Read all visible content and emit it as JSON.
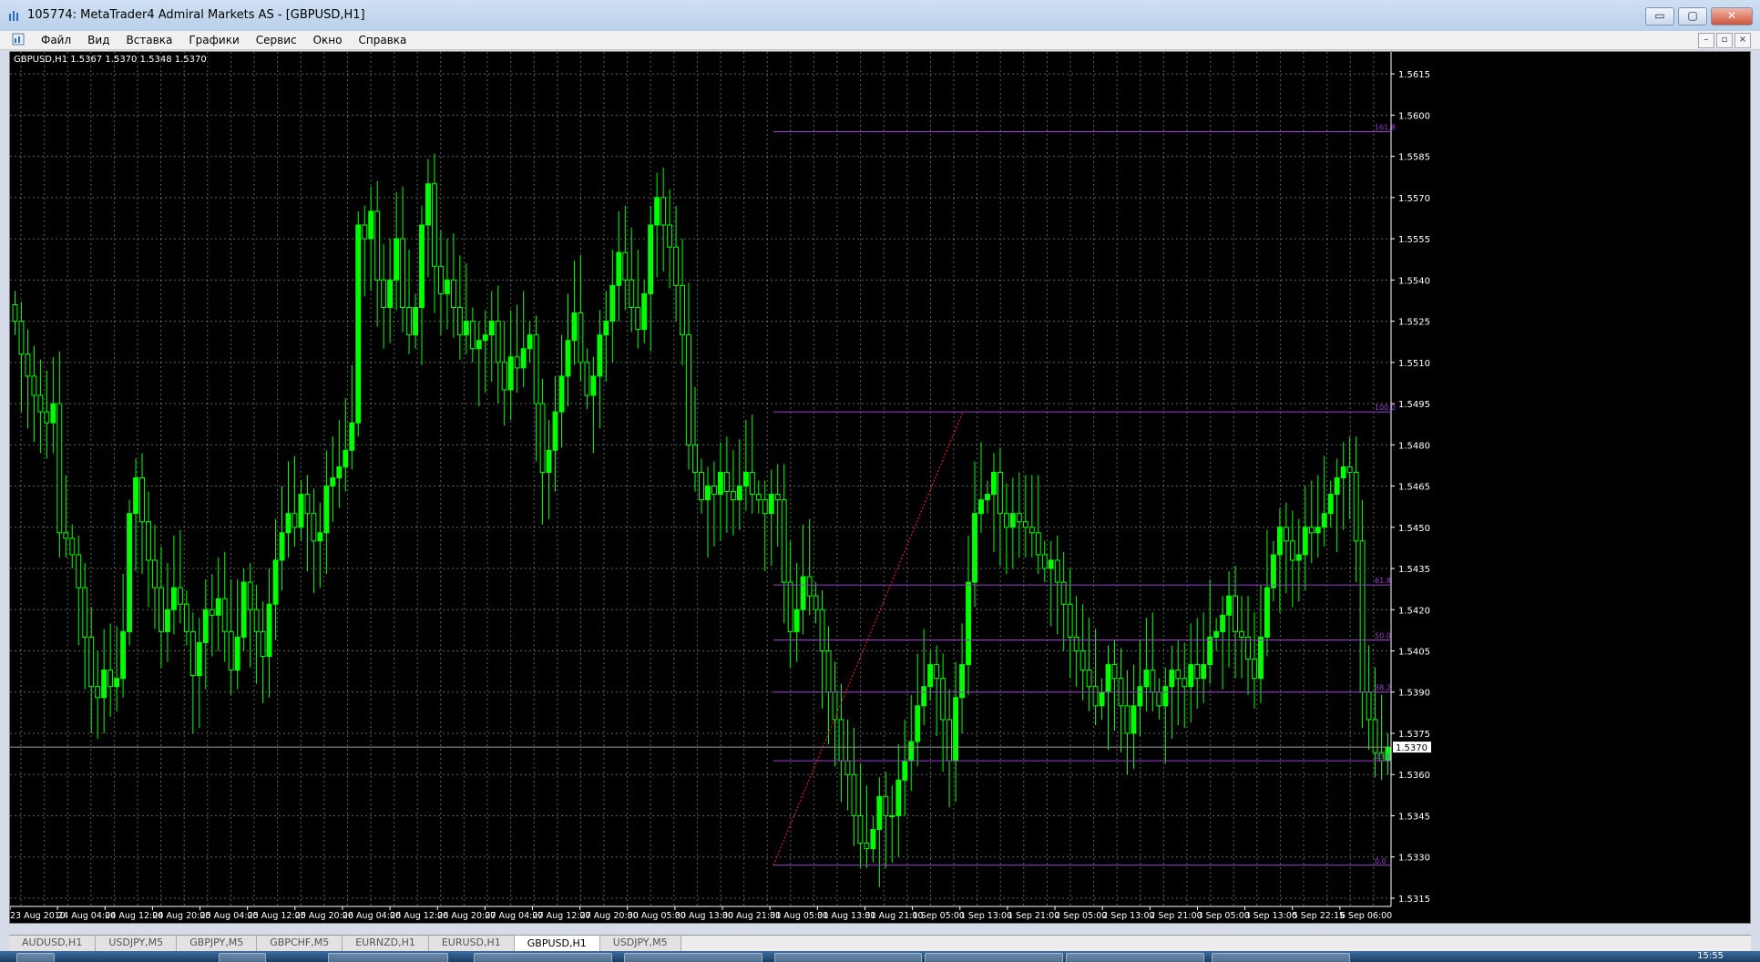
{
  "window": {
    "title": "105774: MetaTrader4 Admiral Markets AS - [GBPUSD,H1]",
    "controls": {
      "minimize": "▭",
      "restore": "▢",
      "close": "✕"
    }
  },
  "menu": {
    "items": [
      "Файл",
      "Вид",
      "Вставка",
      "Графики",
      "Сервис",
      "Окно",
      "Справка"
    ],
    "mdi_controls": {
      "minimize": "–",
      "restore": "▫",
      "close": "×"
    }
  },
  "chart_data": {
    "type": "candlestick",
    "symbol_header": "GBPUSD,H1  1.5367 1.5370 1.5348 1.5370",
    "current_price": "1.5370",
    "price_axis": [
      "1.5615",
      "1.5600",
      "1.5585",
      "1.5570",
      "1.5555",
      "1.5540",
      "1.5525",
      "1.5510",
      "1.5495",
      "1.5480",
      "1.5465",
      "1.5450",
      "1.5435",
      "1.5420",
      "1.5405",
      "1.5390",
      "1.5375",
      "1.5360",
      "1.5345",
      "1.5330",
      "1.5315"
    ],
    "ylim": [
      1.5312,
      1.5623
    ],
    "time_axis": [
      "23 Aug 2010",
      "24 Aug 04:00",
      "24 Aug 12:00",
      "24 Aug 20:00",
      "25 Aug 04:00",
      "25 Aug 12:00",
      "25 Aug 20:00",
      "26 Aug 04:00",
      "26 Aug 12:00",
      "26 Aug 20:00",
      "27 Aug 04:00",
      "27 Aug 12:00",
      "27 Aug 20:00",
      "30 Aug 05:00",
      "30 Aug 13:00",
      "30 Aug 21:00",
      "31 Aug 05:00",
      "31 Aug 13:00",
      "31 Aug 21:00",
      "1 Sep 05:00",
      "1 Sep 13:00",
      "1 Sep 21:00",
      "2 Sep 05:00",
      "2 Sep 13:00",
      "2 Sep 21:00",
      "3 Sep 05:00",
      "3 Sep 13:00",
      "5 Sep 22:15",
      "6 Sep 06:00"
    ],
    "closes": [
      1.5525,
      1.5513,
      1.5505,
      1.5498,
      1.5492,
      1.5488,
      1.5495,
      1.5448,
      1.5446,
      1.544,
      1.5428,
      1.541,
      1.5392,
      1.5388,
      1.5398,
      1.5392,
      1.5395,
      1.5412,
      1.5455,
      1.5468,
      1.5452,
      1.5438,
      1.5428,
      1.5412,
      1.542,
      1.5428,
      1.5422,
      1.5412,
      1.5396,
      1.5408,
      1.542,
      1.5418,
      1.5424,
      1.5412,
      1.5398,
      1.541,
      1.543,
      1.542,
      1.5412,
      1.5403,
      1.5422,
      1.5438,
      1.5448,
      1.5455,
      1.545,
      1.5462,
      1.5455,
      1.5445,
      1.5448,
      1.5465,
      1.5468,
      1.5472,
      1.5478,
      1.5488,
      1.556,
      1.5555,
      1.5565,
      1.554,
      1.553,
      1.554,
      1.5555,
      1.553,
      1.552,
      1.553,
      1.556,
      1.5575,
      1.5545,
      1.5535,
      1.554,
      1.553,
      1.552,
      1.5525,
      1.5515,
      1.5518,
      1.552,
      1.5525,
      1.551,
      1.55,
      1.5512,
      1.5508,
      1.5515,
      1.552,
      1.5495,
      1.547,
      1.5478,
      1.5492,
      1.5505,
      1.5518,
      1.5528,
      1.551,
      1.5498,
      1.5505,
      1.552,
      1.5525,
      1.5538,
      1.555,
      1.554,
      1.553,
      1.5522,
      1.5535,
      1.556,
      1.557,
      1.556,
      1.5552,
      1.5538,
      1.552,
      1.548,
      1.547,
      1.546,
      1.5465,
      1.5462,
      1.547,
      1.5463,
      1.546,
      1.5465,
      1.547,
      1.5462,
      1.546,
      1.5455,
      1.5462,
      1.546,
      1.543,
      1.5412,
      1.542,
      1.5432,
      1.5425,
      1.542,
      1.5405,
      1.539,
      1.538,
      1.5365,
      1.536,
      1.5345,
      1.5335,
      1.5333,
      1.534,
      1.5352,
      1.5345,
      1.5345,
      1.5358,
      1.5365,
      1.5372,
      1.5385,
      1.5392,
      1.54,
      1.5395,
      1.538,
      1.5365,
      1.5388,
      1.54,
      1.543,
      1.5455,
      1.546,
      1.5462,
      1.547,
      1.5455,
      1.545,
      1.5455,
      1.5452,
      1.545,
      1.5448,
      1.544,
      1.5435,
      1.5438,
      1.543,
      1.5422,
      1.541,
      1.5405,
      1.5398,
      1.5392,
      1.5385,
      1.539,
      1.54,
      1.5395,
      1.5385,
      1.5375,
      1.5385,
      1.5392,
      1.5398,
      1.539,
      1.5385,
      1.5392,
      1.5398,
      1.5395,
      1.5392,
      1.54,
      1.5395,
      1.54,
      1.541,
      1.5412,
      1.5418,
      1.5425,
      1.5412,
      1.541,
      1.5402,
      1.5395,
      1.541,
      1.5428,
      1.544,
      1.545,
      1.5445,
      1.5438,
      1.544,
      1.545,
      1.5448,
      1.545,
      1.5455,
      1.5462,
      1.5468,
      1.5472,
      1.547,
      1.5445,
      1.539,
      1.538,
      1.5368,
      1.5365,
      1.537
    ],
    "fibonacci": {
      "levels": [
        {
          "label": "161.8",
          "price": 1.5594
        },
        {
          "label": "100.0",
          "price": 1.5492
        },
        {
          "label": "61.8",
          "price": 1.5429
        },
        {
          "label": "50.0",
          "price": 1.5409
        },
        {
          "label": "38.2",
          "price": 1.539
        },
        {
          "label": "23.6",
          "price": 1.5365
        },
        {
          "label": "0.0",
          "price": 1.5327
        }
      ],
      "trend_start_price": 1.5327,
      "trend_end_price": 1.5492
    },
    "colors": {
      "background": "#000000",
      "grid": "#b0b0b0",
      "bull": "#00ff00",
      "bear": "#000000",
      "wick": "#00ff00",
      "fib": "#9a3fd0",
      "trend": "#ff2020",
      "axis_text": "#ffffff"
    }
  },
  "tabs": [
    "AUDUSD,H1",
    "USDJPY,M5",
    "GBPJPY,M5",
    "GBPCHF,M5",
    "EURNZD,H1",
    "EURUSD,H1",
    "GBPUSD,H1",
    "USDJPY,M5"
  ],
  "active_tab": "GBPUSD,H1",
  "taskbar": {
    "clock": "15:55"
  }
}
